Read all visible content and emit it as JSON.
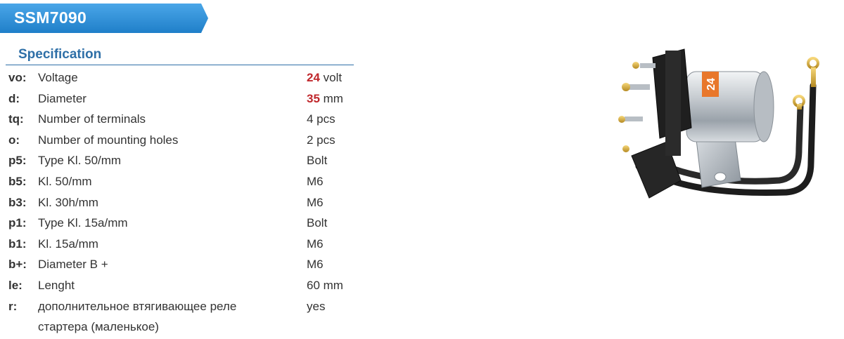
{
  "product": {
    "code": "SSM7090"
  },
  "spec": {
    "heading": "Specification",
    "rows": [
      {
        "code": "vo:",
        "label": "Voltage",
        "value_num": "24",
        "value_unit": " volt",
        "highlight": true
      },
      {
        "code": "d:",
        "label": "Diameter",
        "value_num": "35",
        "value_unit": " mm",
        "highlight": true
      },
      {
        "code": "tq:",
        "label": "Number of terminals",
        "value": "4 pcs"
      },
      {
        "code": "o:",
        "label": "Number of mounting holes",
        "value": "2 pcs"
      },
      {
        "code": "p5:",
        "label": "Type Kl. 50/mm",
        "value": "Bolt"
      },
      {
        "code": "b5:",
        "label": "Kl. 50/mm",
        "value": "M6"
      },
      {
        "code": "b3:",
        "label": "Kl. 30h/mm",
        "value": "M6"
      },
      {
        "code": "p1:",
        "label": "Type Kl. 15a/mm",
        "value": "Bolt"
      },
      {
        "code": "b1:",
        "label": "Kl. 15a/mm",
        "value": "M6"
      },
      {
        "code": "b+:",
        "label": "Diameter B +",
        "value": "M6"
      },
      {
        "code": "le:",
        "label": "Lenght",
        "value": "60 mm"
      },
      {
        "code": "r:",
        "label": "дополнительное втягивающее реле",
        "label2": "стартера (маленькое)",
        "value": "yes"
      }
    ]
  },
  "image": {
    "icon": "solenoid-relay-photo",
    "label": "24"
  },
  "colors": {
    "banner": "#2e8fd6",
    "heading": "#2e6fa7",
    "highlight": "#c0282d"
  }
}
